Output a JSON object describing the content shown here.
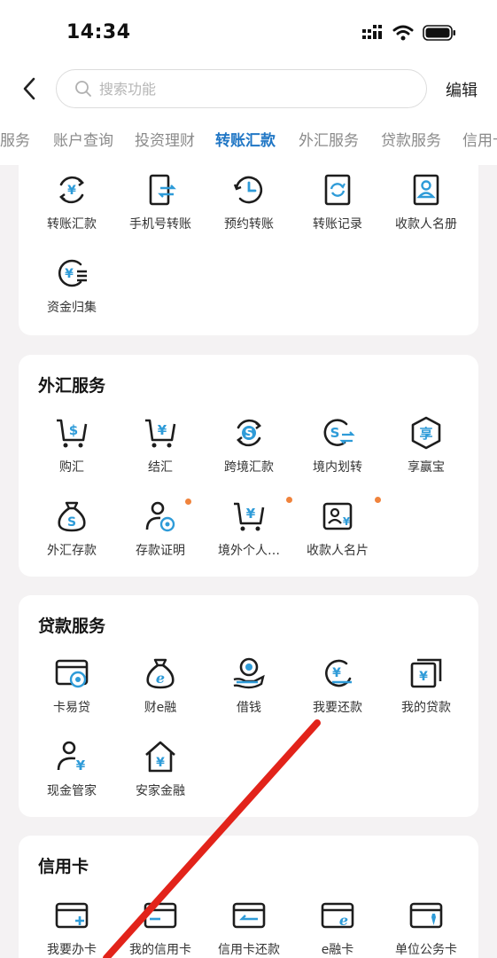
{
  "status_bar": {
    "time": "14:34"
  },
  "header": {
    "search_placeholder": "搜索功能",
    "edit_label": "编辑"
  },
  "tabs": [
    "服务",
    "账户查询",
    "投资理财",
    "转账汇款",
    "外汇服务",
    "贷款服务",
    "信用卡"
  ],
  "active_tab": "转账汇款",
  "accent_color": "#2177c5",
  "transfer_section": {
    "items": [
      {
        "label": "转账汇款",
        "icon": "yuan-circle-arrows-icon"
      },
      {
        "label": "手机号转账",
        "icon": "phone-transfer-icon"
      },
      {
        "label": "预约转账",
        "icon": "clock-circle-icon"
      },
      {
        "label": "转账记录",
        "icon": "record-refresh-icon"
      },
      {
        "label": "收款人名册",
        "icon": "payee-book-icon"
      },
      {
        "label": "资金归集",
        "icon": "yuan-collect-icon"
      }
    ]
  },
  "forex_section": {
    "title": "外汇服务",
    "items": [
      {
        "label": "购汇",
        "icon": "cart-dollar-icon"
      },
      {
        "label": "结汇",
        "icon": "cart-yuan-icon"
      },
      {
        "label": "跨境汇款",
        "icon": "dollar-circle-arrows-icon"
      },
      {
        "label": "境内划转",
        "icon": "dollar-transfer-icon"
      },
      {
        "label": "享赢宝",
        "icon": "hexagon-badge-icon"
      },
      {
        "label": "外汇存款",
        "icon": "money-bag-dollar-icon"
      },
      {
        "label": "存款证明",
        "icon": "person-badge-icon"
      },
      {
        "label": "境外个人…",
        "icon": "cart-yuan-icon"
      },
      {
        "label": "收款人名片",
        "icon": "payee-card-icon"
      }
    ]
  },
  "loan_section": {
    "title": "贷款服务",
    "items": [
      {
        "label": "卡易贷",
        "icon": "card-coin-icon"
      },
      {
        "label": "财e融",
        "icon": "money-bag-e-icon"
      },
      {
        "label": "借钱",
        "icon": "hand-coin-icon"
      },
      {
        "label": "我要还款",
        "icon": "yuan-repay-icon"
      },
      {
        "label": "我的贷款",
        "icon": "cards-yuan-icon"
      },
      {
        "label": "现金管家",
        "icon": "person-yuan-icon"
      },
      {
        "label": "安家金融",
        "icon": "house-yuan-icon"
      }
    ]
  },
  "credit_section": {
    "title": "信用卡",
    "items": [
      {
        "label": "我要办卡",
        "icon": "card-plus-icon"
      },
      {
        "label": "我的信用卡",
        "icon": "card-icon"
      },
      {
        "label": "信用卡还款",
        "icon": "card-return-icon"
      },
      {
        "label": "e融卡",
        "icon": "card-e-icon"
      },
      {
        "label": "单位公务卡",
        "icon": "card-tie-icon"
      }
    ]
  }
}
